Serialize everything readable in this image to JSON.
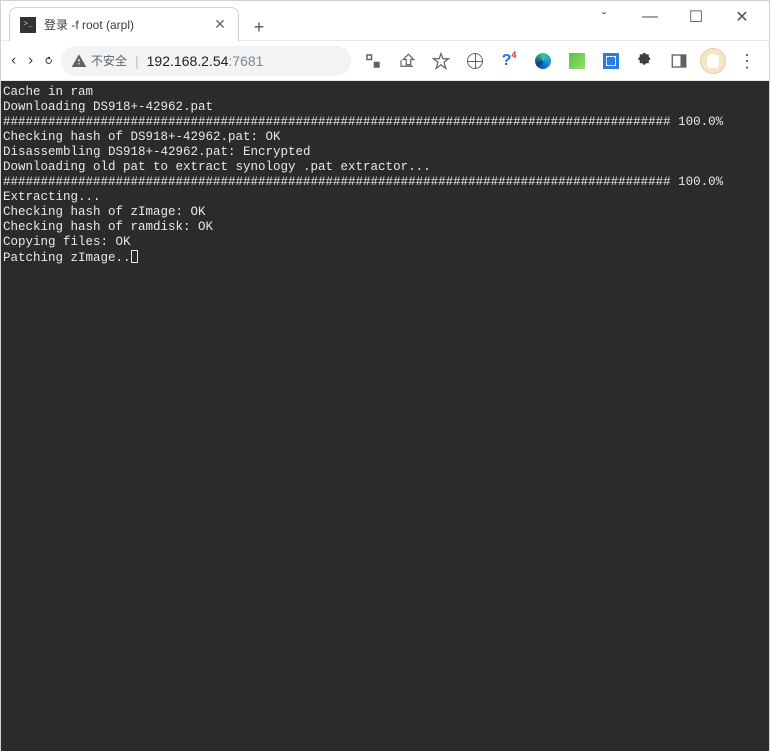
{
  "window": {
    "chevron": "ˇ",
    "minimize": "—",
    "maximize": "☐",
    "close": "✕"
  },
  "tab": {
    "title": "登录 -f root (arpl)",
    "close": "✕",
    "newtab": "+"
  },
  "nav": {
    "back": "←",
    "forward": "→",
    "reload": "⟳"
  },
  "address": {
    "warn_label": "不安全",
    "host": "192.168.2.54",
    "port": ":7681"
  },
  "toolbar": {
    "translate": "⊞",
    "share": "↗",
    "star": "☆",
    "menu": "⋮"
  },
  "terminal": {
    "lines": [
      "Cache in ram",
      "Downloading DS918+-42962.pat",
      "######################################################################################### 100.0%",
      "Checking hash of DS918+-42962.pat: OK",
      "Disassembling DS918+-42962.pat: Encrypted",
      "Downloading old pat to extract synology .pat extractor...",
      "######################################################################################### 100.0%",
      "Extracting...",
      "Checking hash of zImage: OK",
      "Checking hash of ramdisk: OK",
      "Copying files: OK",
      "Patching zImage.."
    ]
  }
}
